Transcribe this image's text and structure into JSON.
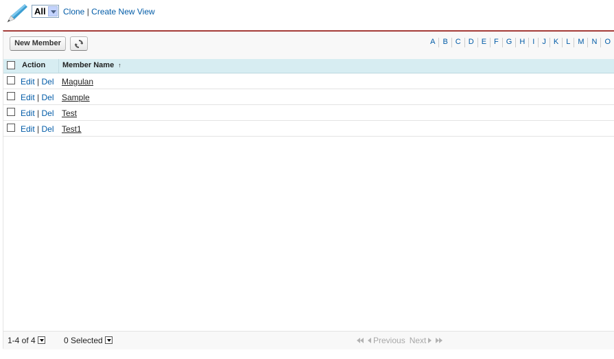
{
  "header": {
    "view_selected": "All",
    "clone_label": "Clone",
    "separator": "|",
    "create_view_label": "Create New View"
  },
  "toolbar": {
    "new_button_label": "New Member",
    "alphabet": [
      "A",
      "B",
      "C",
      "D",
      "E",
      "F",
      "G",
      "H",
      "I",
      "J",
      "K",
      "L",
      "M",
      "N",
      "O"
    ]
  },
  "table": {
    "columns": {
      "action": "Action",
      "name": "Member Name",
      "sort_indicator": "↑"
    },
    "rows": [
      {
        "edit": "Edit",
        "sep": "|",
        "del": "Del",
        "name": "Magulan"
      },
      {
        "edit": "Edit",
        "sep": "|",
        "del": "Del",
        "name": "Sample"
      },
      {
        "edit": "Edit",
        "sep": "|",
        "del": "Del",
        "name": "Test"
      },
      {
        "edit": "Edit",
        "sep": "|",
        "del": "Del",
        "name": "Test1"
      }
    ]
  },
  "footer": {
    "record_count": "1-4 of 4",
    "selected_count": "0 Selected",
    "previous_label": "Previous",
    "next_label": "Next"
  },
  "colors": {
    "accent_border": "#a43b37",
    "link": "#015ba7",
    "header_row": "#d7edf2"
  }
}
